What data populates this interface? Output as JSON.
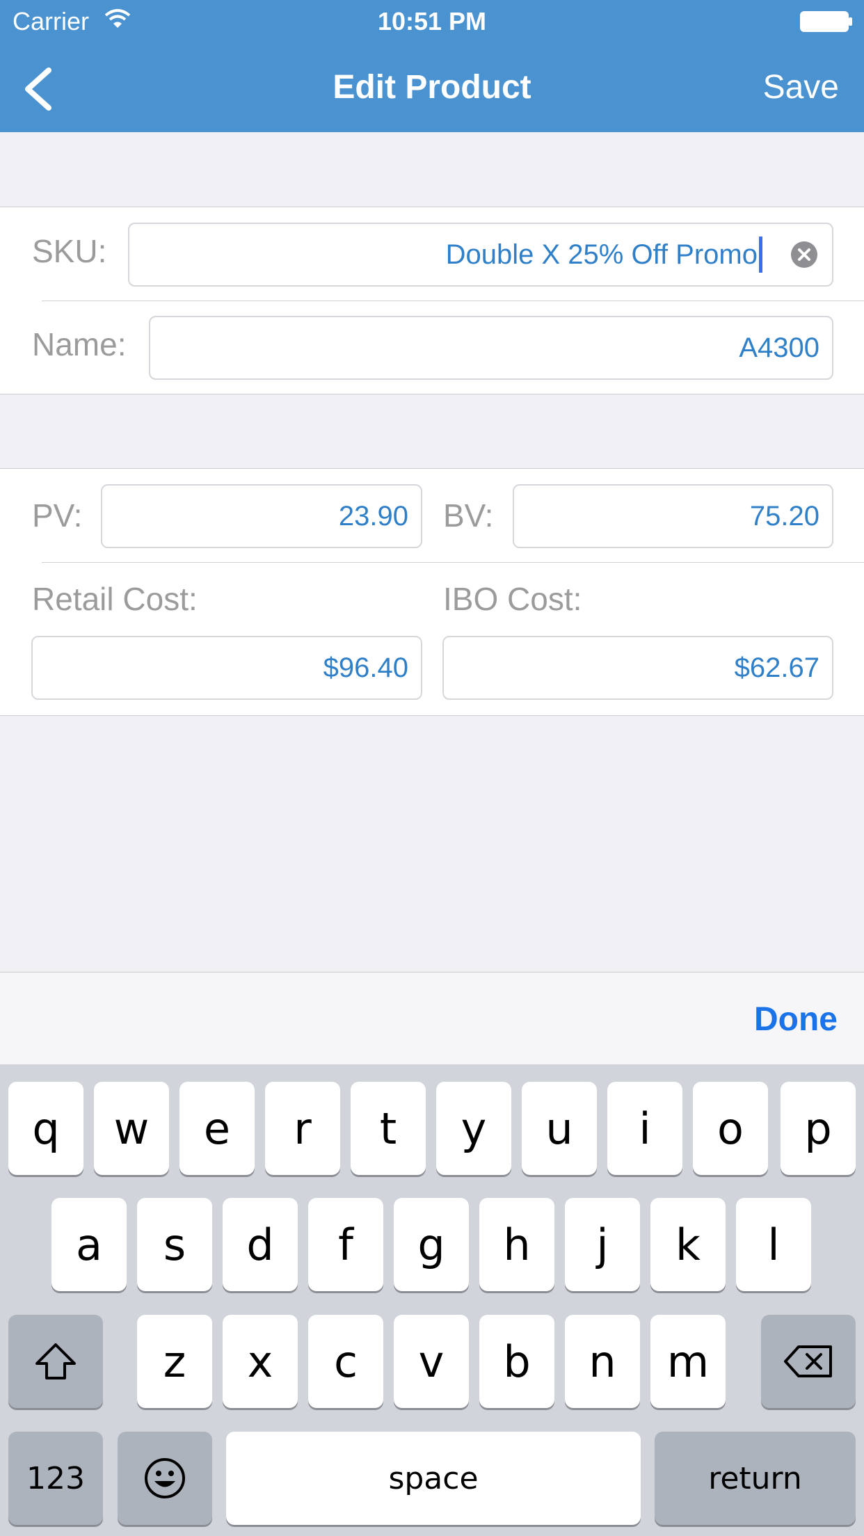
{
  "status_bar": {
    "carrier": "Carrier",
    "time": "10:51 PM"
  },
  "nav": {
    "title": "Edit Product",
    "save_label": "Save"
  },
  "form": {
    "sku": {
      "label": "SKU:",
      "value": "Double X 25% Off Promo"
    },
    "name": {
      "label": "Name:",
      "value": "A4300"
    },
    "pv": {
      "label": "PV:",
      "value": "23.90"
    },
    "bv": {
      "label": "BV:",
      "value": "75.20"
    },
    "retail_cost": {
      "label": "Retail Cost:",
      "value": "$96.40"
    },
    "ibo_cost": {
      "label": "IBO Cost:",
      "value": "$62.67"
    }
  },
  "accessory": {
    "done_label": "Done"
  },
  "keyboard": {
    "row1": [
      "q",
      "w",
      "e",
      "r",
      "t",
      "y",
      "u",
      "i",
      "o",
      "p"
    ],
    "row2": [
      "a",
      "s",
      "d",
      "f",
      "g",
      "h",
      "j",
      "k",
      "l"
    ],
    "row3": [
      "z",
      "x",
      "c",
      "v",
      "b",
      "n",
      "m"
    ],
    "numbers_label": "123",
    "space_label": "space",
    "return_label": "return"
  },
  "colors": {
    "nav_bar": "#4a92d0",
    "field_value": "#2f80c8",
    "done": "#1a73e8"
  }
}
